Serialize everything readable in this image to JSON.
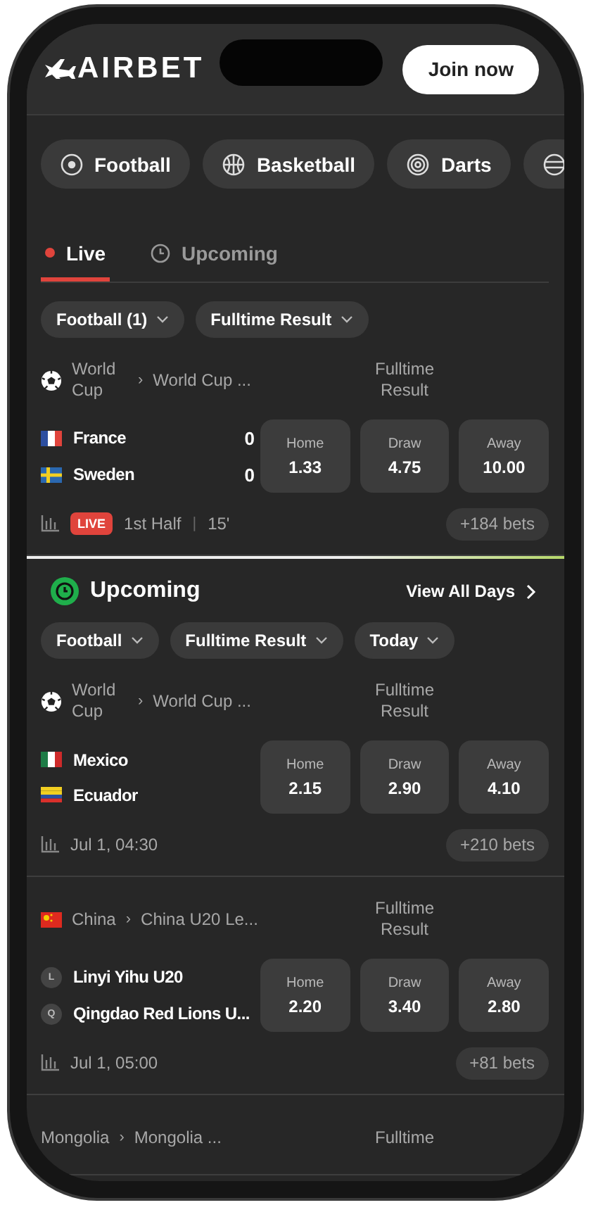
{
  "header": {
    "logo": "AIRBET",
    "join_button": "Join now"
  },
  "sports": [
    {
      "label": "Football"
    },
    {
      "label": "Basketball"
    },
    {
      "label": "Darts"
    }
  ],
  "tabs": [
    {
      "kind": "live",
      "label": "Live",
      "selected": true
    },
    {
      "kind": "upcoming",
      "label": "Upcoming",
      "selected": false
    }
  ],
  "live_filters": [
    "Football (1)",
    "Fulltime Result"
  ],
  "live_matches": [
    {
      "league": {
        "kind": "ball",
        "name": "World Cup"
      },
      "separator": "›",
      "competition": "World Cup ...",
      "market": "Fulltime Result",
      "teams": [
        {
          "kind": "fr",
          "name": "France",
          "score": "0"
        },
        {
          "kind": "se",
          "name": "Sweden",
          "score": "0"
        }
      ],
      "odds": [
        {
          "label": "Home",
          "value": "1.33"
        },
        {
          "label": "Draw",
          "value": "4.75"
        },
        {
          "label": "Away",
          "value": "10.00"
        }
      ],
      "badge": "LIVE",
      "period": "1st Half",
      "divider": "|",
      "minute": "15'",
      "bets": "+184 bets"
    }
  ],
  "upcoming": {
    "title": "Upcoming",
    "view_all": "View All Days",
    "filters": [
      "Football",
      "Fulltime Result",
      "Today"
    ],
    "matches": [
      {
        "league": {
          "kind": "ball",
          "name": "World Cup"
        },
        "separator": "›",
        "competition": "World Cup ...",
        "market": "Fulltime Result",
        "teams": [
          {
            "kind": "mx",
            "name": "Mexico"
          },
          {
            "kind": "ec",
            "name": "Ecuador"
          }
        ],
        "odds": [
          {
            "label": "Home",
            "value": "2.15"
          },
          {
            "label": "Draw",
            "value": "2.90"
          },
          {
            "label": "Away",
            "value": "4.10"
          }
        ],
        "time": "Jul 1, 04:30",
        "bets": "+210 bets"
      },
      {
        "league": {
          "kind": "cn",
          "name": "China"
        },
        "separator": "›",
        "competition": "China U20 Le...",
        "market": "Fulltime Result",
        "teams": [
          {
            "kind": "letter",
            "letter": "L",
            "name": "Linyi Yihu U20"
          },
          {
            "kind": "letter",
            "letter": "Q",
            "name": "Qingdao Red Lions U..."
          }
        ],
        "odds": [
          {
            "label": "Home",
            "value": "2.20"
          },
          {
            "label": "Draw",
            "value": "3.40"
          },
          {
            "label": "Away",
            "value": "2.80"
          }
        ],
        "time": "Jul 1, 05:00",
        "bets": "+81 bets"
      },
      {
        "league": {
          "name": "Mongolia"
        },
        "separator": "›",
        "competition": "Mongolia ...",
        "market": "Fulltime"
      }
    ]
  }
}
